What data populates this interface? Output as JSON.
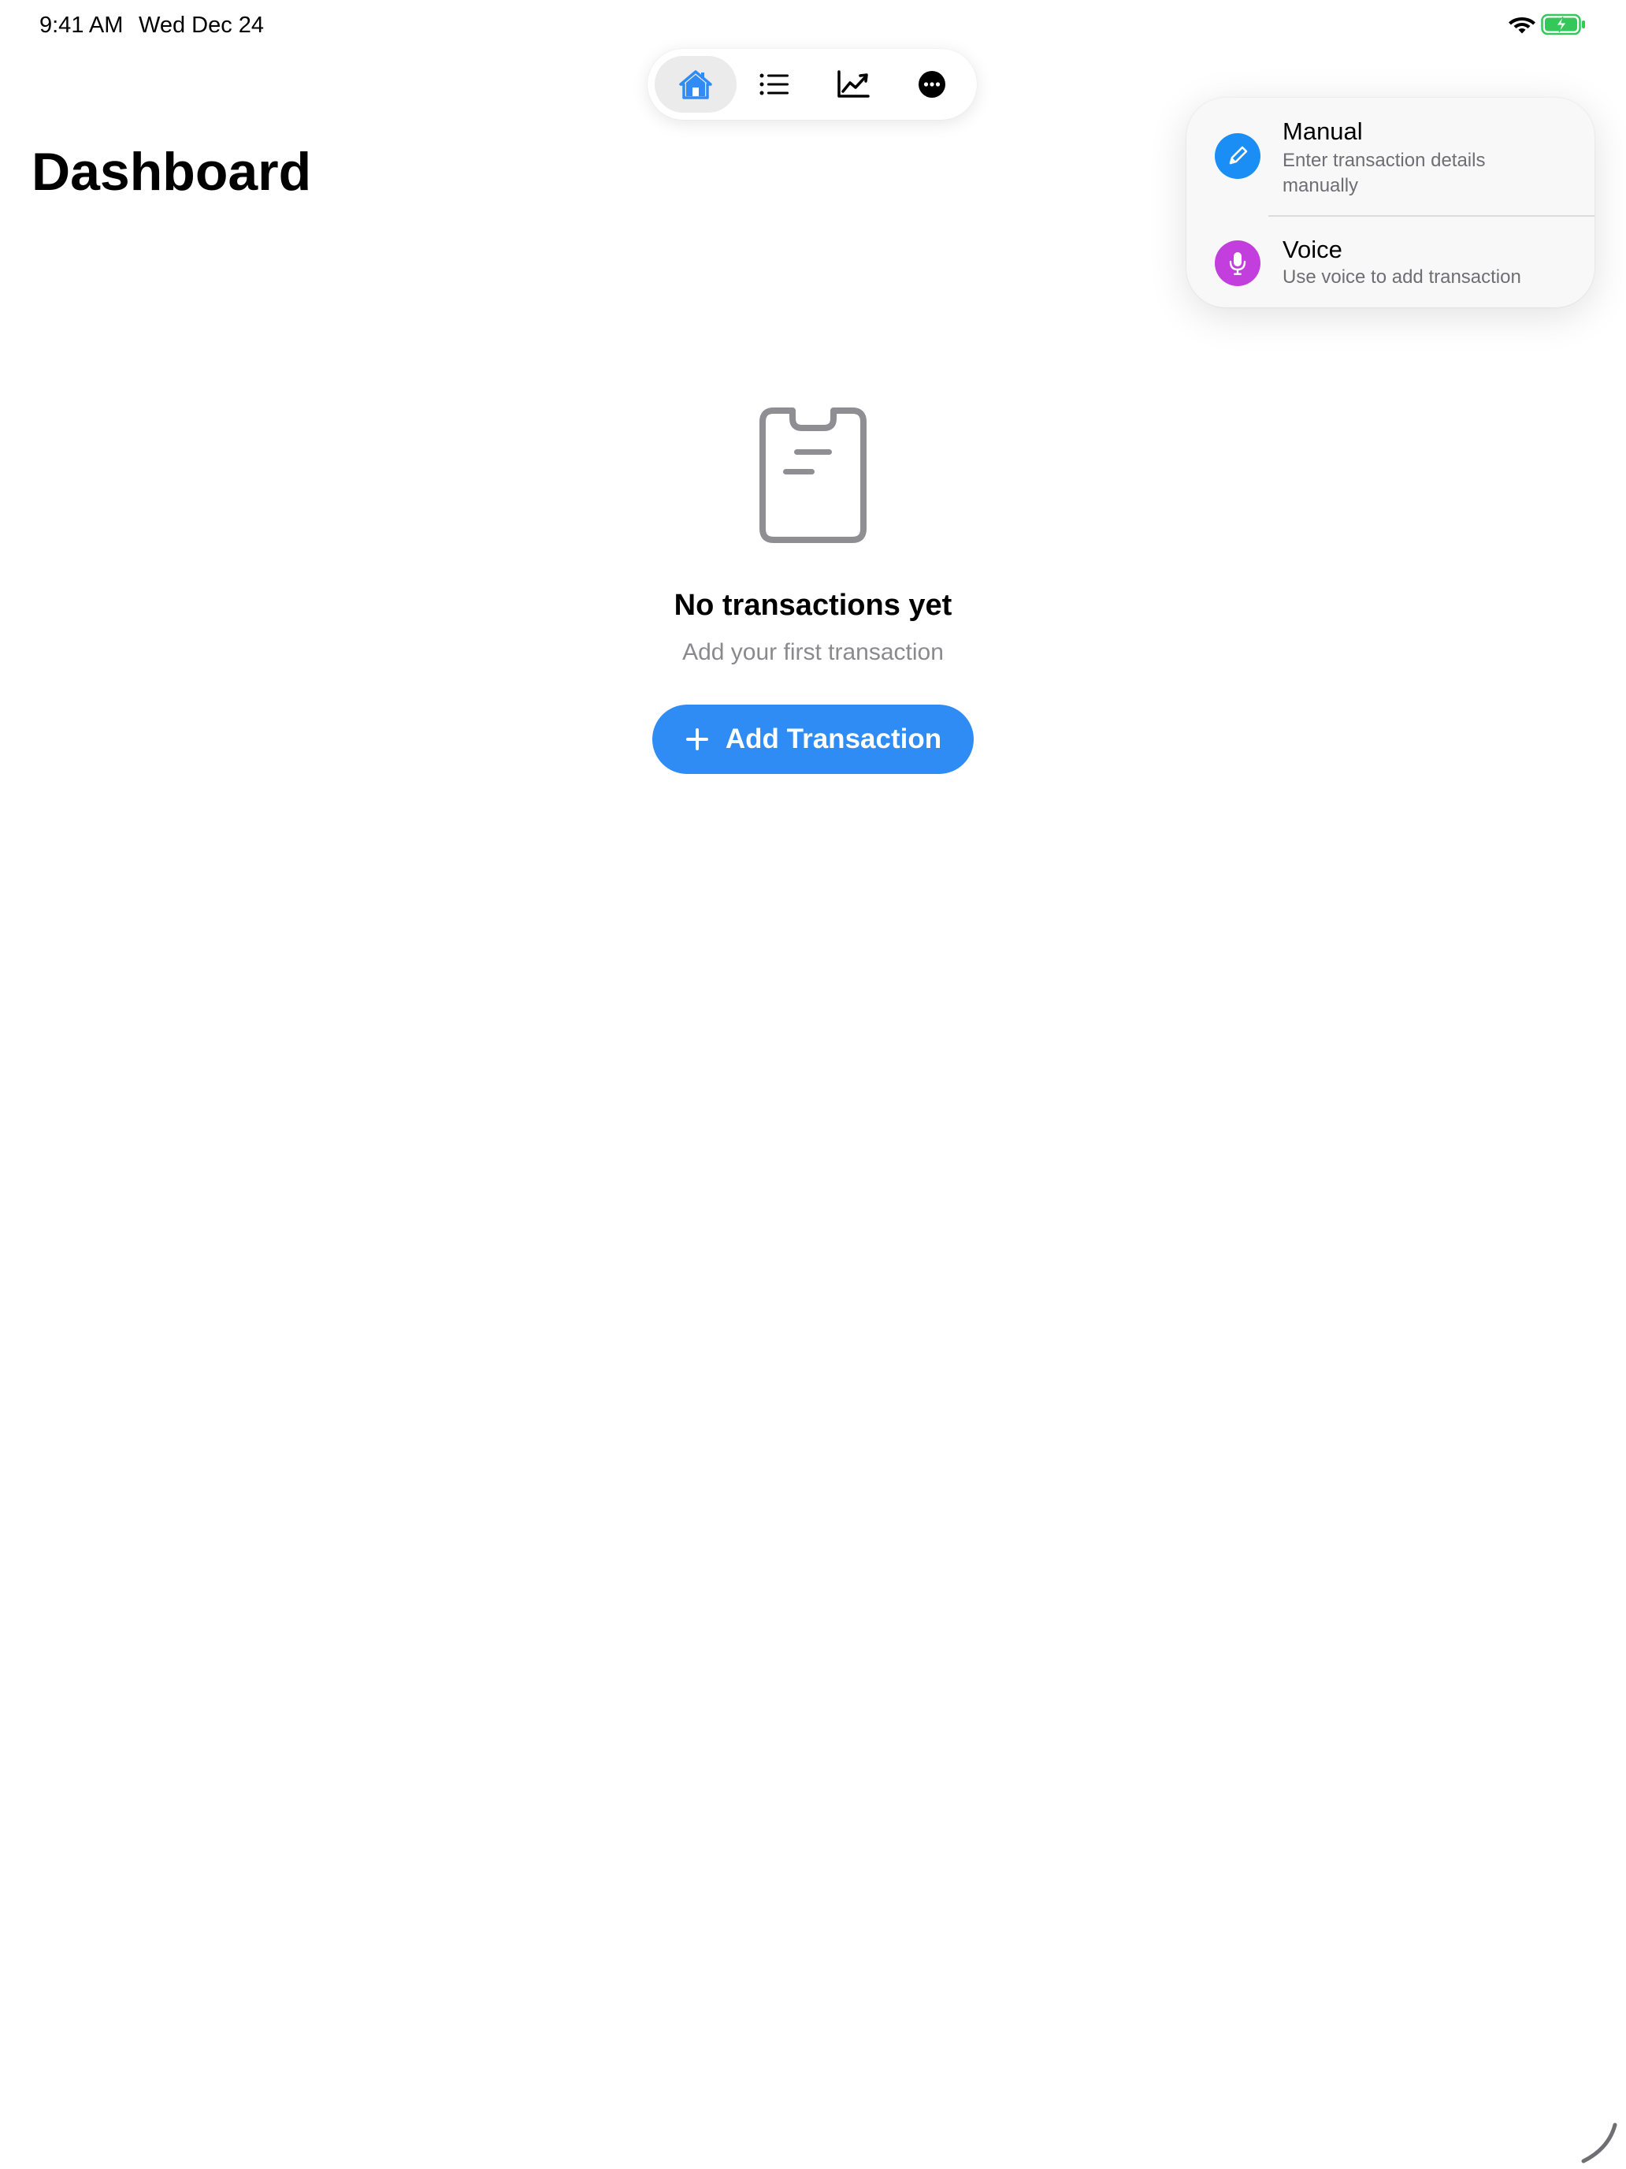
{
  "status_bar": {
    "time": "9:41 AM",
    "date": "Wed Dec 24",
    "icons": [
      "wifi-icon",
      "battery-charging-icon"
    ]
  },
  "tabbar": {
    "tabs": [
      {
        "name": "home",
        "icon": "house-icon",
        "active": true
      },
      {
        "name": "list",
        "icon": "list-icon",
        "active": false
      },
      {
        "name": "chart",
        "icon": "chart-line-icon",
        "active": false
      },
      {
        "name": "more",
        "icon": "ellipsis-circle-icon",
        "active": false
      }
    ],
    "active_color": "#2f8cf4"
  },
  "page": {
    "title": "Dashboard"
  },
  "empty_state": {
    "icon": "clipboard-icon",
    "title": "No transactions yet",
    "subtitle": "Add your first transaction",
    "button_label": "Add Transaction",
    "button_color": "#2f8cf4"
  },
  "add_menu": {
    "items": [
      {
        "label": "Manual",
        "description": "Enter transaction details manually",
        "icon": "pencil-icon",
        "color": "#1a8ef5"
      },
      {
        "label": "Voice",
        "description": "Use voice to add transaction",
        "icon": "microphone-icon",
        "color": "#c23fdd"
      }
    ]
  }
}
